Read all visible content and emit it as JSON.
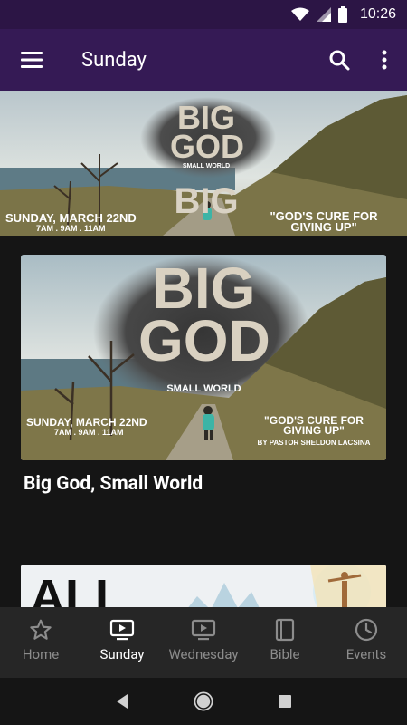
{
  "status_bar": {
    "time": "10:26"
  },
  "app_bar": {
    "title": "Sunday"
  },
  "hero": {
    "big": "BIG",
    "god": "GOD",
    "small_world": "SMALL WORLD",
    "date": "SUNDAY, MARCH 22ND",
    "times": "7AM . 9AM . 11AM",
    "sermon_line1": "\"GOD'S CURE FOR",
    "sermon_line2": "GIVING UP\""
  },
  "cards": [
    {
      "title": "Big God, Small World",
      "image": {
        "big": "BIG",
        "god": "GOD",
        "small_world": "SMALL WORLD",
        "date": "SUNDAY, MARCH 22ND",
        "times": "7AM . 9AM . 11AM",
        "sermon_line1": "\"GOD'S CURE FOR",
        "sermon_line2": "GIVING UP\"",
        "byline": "BY PASTOR SHELDON LACSINA"
      }
    },
    {
      "image": {
        "headline": "ALL"
      }
    }
  ],
  "bottom_nav": {
    "items": [
      {
        "label": "Home",
        "icon": "star-icon"
      },
      {
        "label": "Sunday",
        "icon": "tv-icon"
      },
      {
        "label": "Wednesday",
        "icon": "tv-icon"
      },
      {
        "label": "Bible",
        "icon": "book-icon"
      },
      {
        "label": "Events",
        "icon": "clock-icon"
      }
    ],
    "active_index": 1
  },
  "colors": {
    "status_bar": "#2c1545",
    "app_bar": "#351a55",
    "background": "#151515",
    "bottom_nav": "#262626"
  }
}
